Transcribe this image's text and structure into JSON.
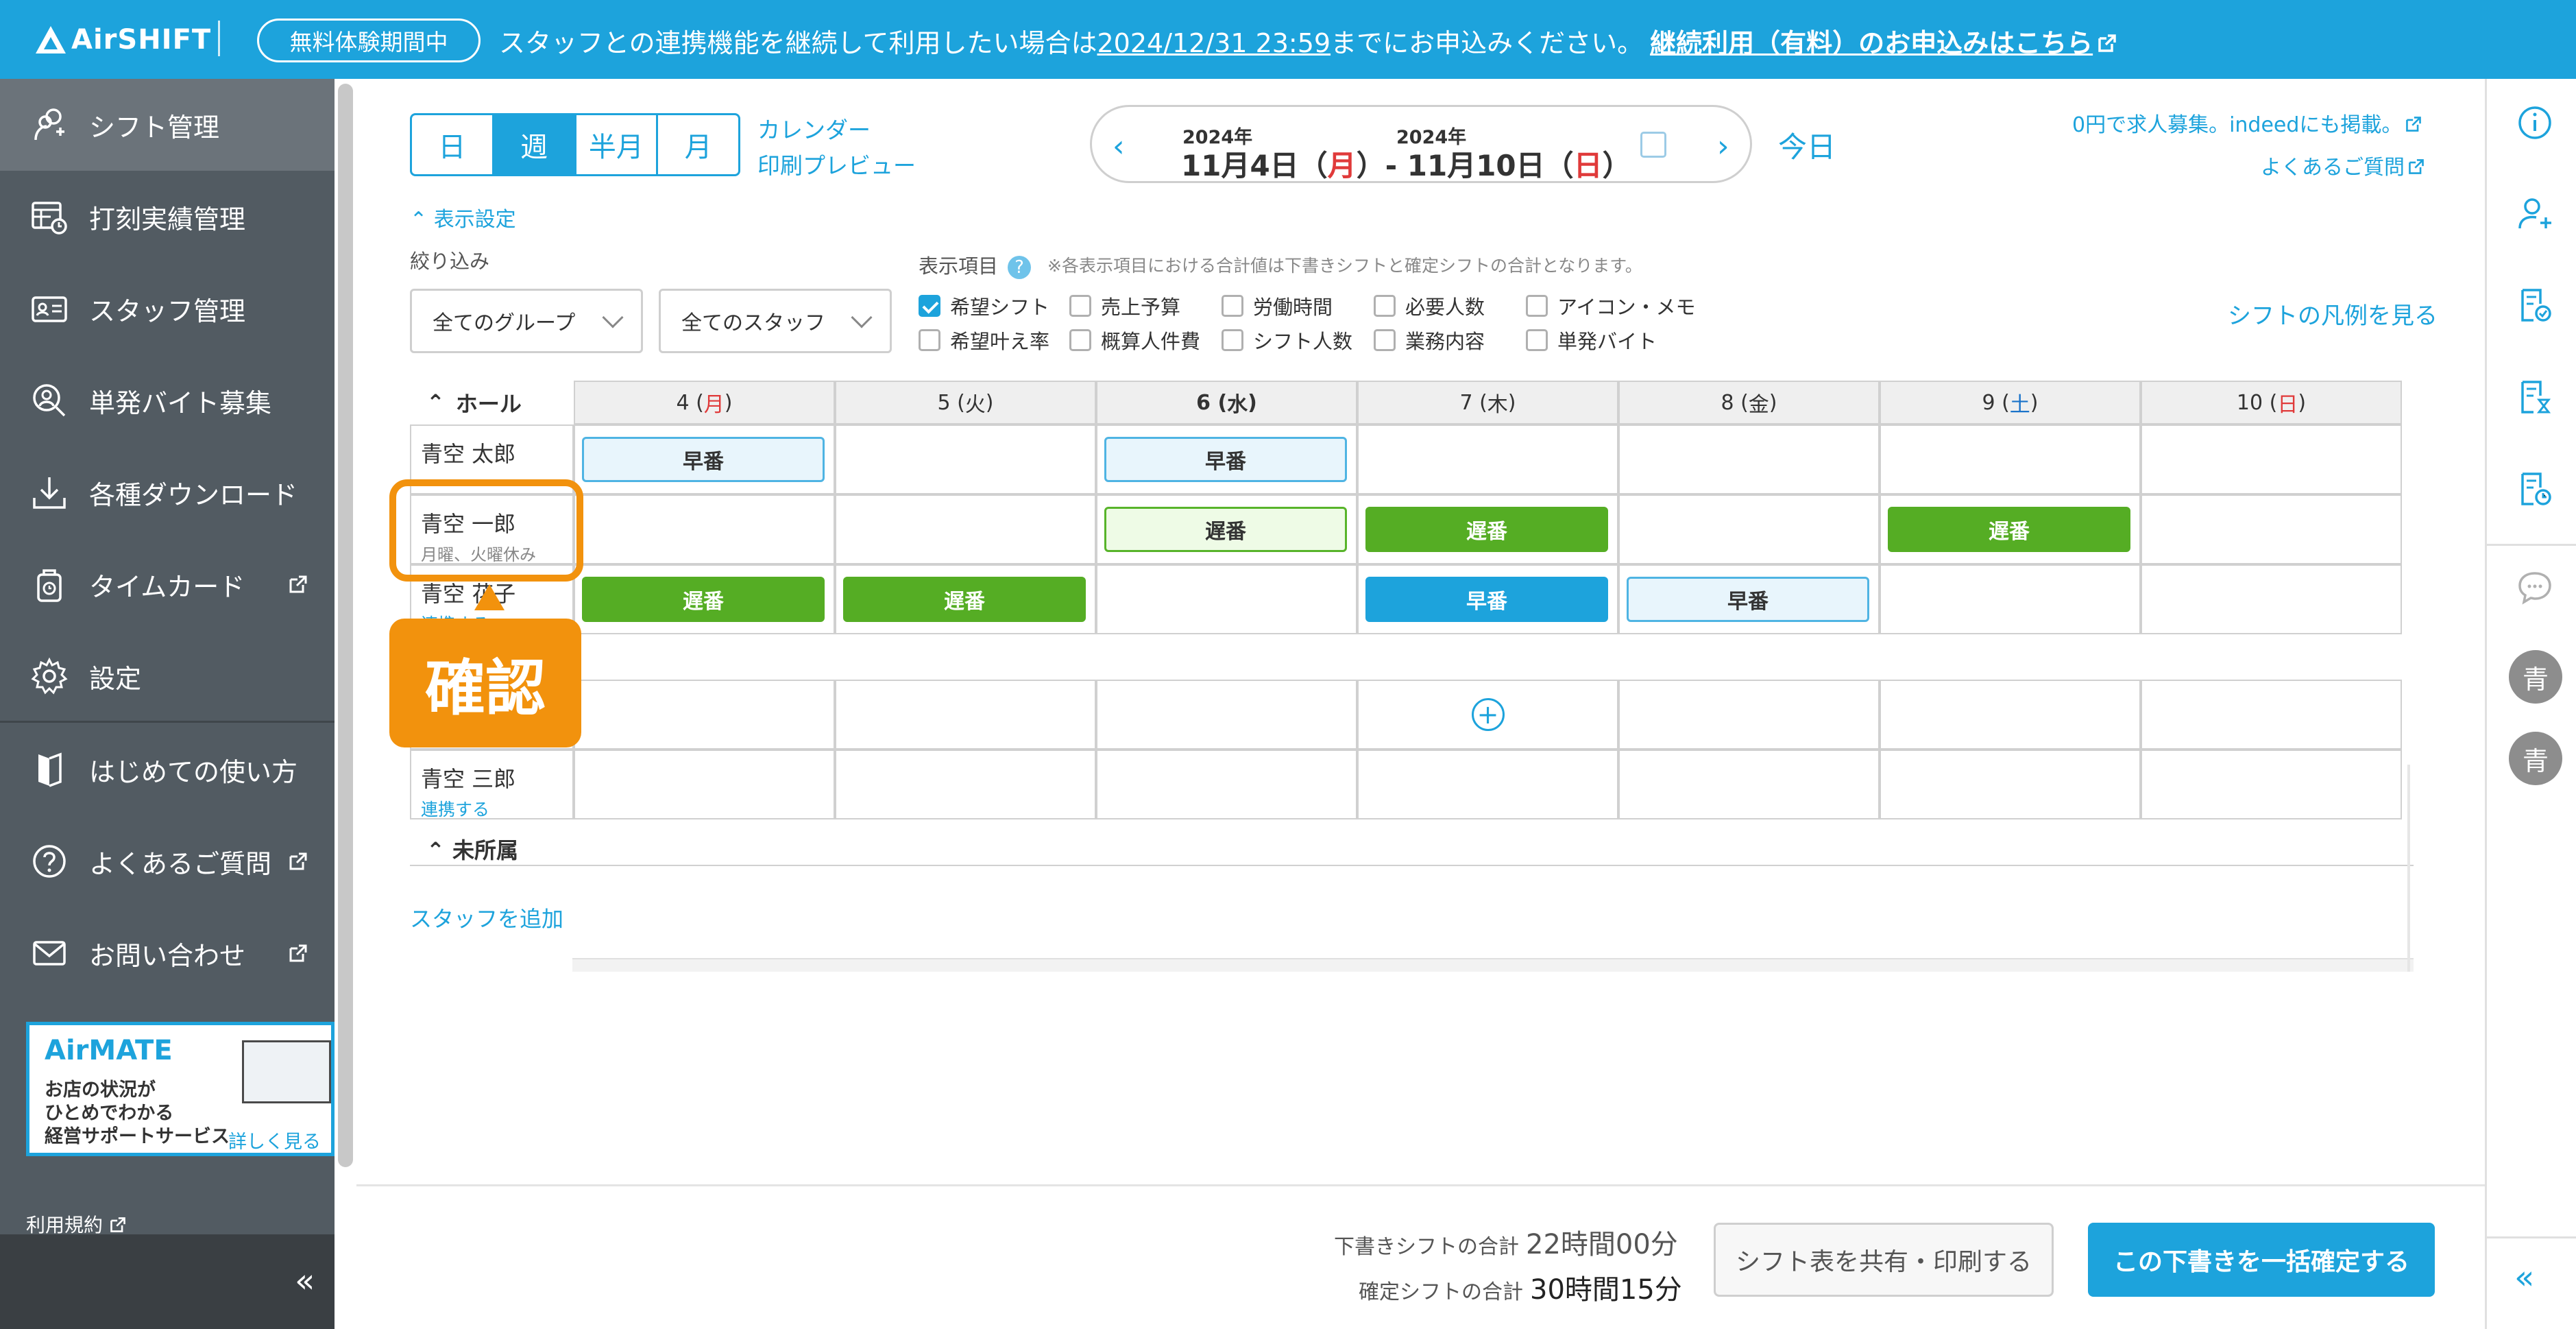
{
  "banner": {
    "brand": "AirSHIFT",
    "trial_badge": "無料体験期間中",
    "message_prefix": "スタッフとの連携機能を継続して利用したい場合は",
    "deadline": "2024/12/31 23:59",
    "message_suffix": "までにお申込みください。",
    "cta": "継続利用（有料）のお申込みはこちら",
    "bg_color": "#1da3dc"
  },
  "sidebar": {
    "items": [
      {
        "label": "シフト管理",
        "icon": "calendar-person-icon",
        "active": true
      },
      {
        "label": "打刻実績管理",
        "icon": "table-clock-icon"
      },
      {
        "label": "スタッフ管理",
        "icon": "id-card-icon"
      },
      {
        "label": "単発バイト募集",
        "icon": "person-search-icon"
      },
      {
        "label": "各種ダウンロード",
        "icon": "download-icon"
      },
      {
        "label": "タイムカード",
        "icon": "timecard-icon",
        "external": true
      },
      {
        "label": "設定",
        "icon": "gear-icon"
      },
      {
        "label": "はじめての使い方",
        "icon": "bookmark-icon"
      },
      {
        "label": "よくあるご質問",
        "icon": "question-icon",
        "external": true
      },
      {
        "label": "お問い合わせ",
        "icon": "mail-icon",
        "external": true
      }
    ],
    "ad": {
      "brand": "AirMATE",
      "desc_lines": [
        "お店の状況が",
        "ひとめでわかる",
        "経営サポートサービス"
      ],
      "more": "詳しく見る"
    },
    "terms": "利用規約",
    "collapse": "«"
  },
  "toolbar": {
    "views": [
      "日",
      "週",
      "半月",
      "月"
    ],
    "active_view": "週",
    "calendar_link": "カレンダー",
    "print_link": "印刷プレビュー",
    "year_start": "2024年",
    "year_end": "2024年",
    "range_start_md": "11月4日（",
    "range_start_dow": "月",
    "range_sep": "）- 11月10日（",
    "range_end_dow": "日",
    "range_close": "）",
    "today": "今日",
    "indeed_link": "0円で求人募集。indeedにも掲載。",
    "faq_link": "よくあるご質問"
  },
  "settings": {
    "toggle": "表示設定",
    "filter_label": "絞り込み",
    "group_select": "全てのグループ",
    "staff_select": "全てのスタッフ",
    "items_label": "表示項目",
    "note": "※各表示項目における合計値は下書きシフトと確定シフトの合計となります。",
    "checkboxes": [
      {
        "label": "希望シフト",
        "checked": true
      },
      {
        "label": "売上予算",
        "checked": false
      },
      {
        "label": "労働時間",
        "checked": false
      },
      {
        "label": "必要人数",
        "checked": false
      },
      {
        "label": "アイコン・メモ",
        "checked": false
      },
      {
        "label": "希望叶え率",
        "checked": false
      },
      {
        "label": "概算人件費",
        "checked": false
      },
      {
        "label": "シフト人数",
        "checked": false
      },
      {
        "label": "業務内容",
        "checked": false
      },
      {
        "label": "単発バイト",
        "checked": false
      }
    ],
    "legend_link": "シフトの凡例を見る"
  },
  "table": {
    "group": "ホール",
    "days": [
      {
        "num": "4",
        "dow": "月",
        "tone": "red"
      },
      {
        "num": "5",
        "dow": "火",
        "tone": ""
      },
      {
        "num": "6",
        "dow": "水",
        "tone": "",
        "bold": true
      },
      {
        "num": "7",
        "dow": "木",
        "tone": ""
      },
      {
        "num": "8",
        "dow": "金",
        "tone": ""
      },
      {
        "num": "9",
        "dow": "土",
        "tone": "blue"
      },
      {
        "num": "10",
        "dow": "日",
        "tone": "red"
      }
    ],
    "staff": [
      {
        "name": "青空 太郎",
        "sub": "",
        "link": "",
        "shifts": [
          {
            "day": 0,
            "label": "早番",
            "kind": "e-draft"
          },
          {
            "day": 2,
            "label": "早番",
            "kind": "e-draft"
          }
        ]
      },
      {
        "name": "青空 一郎",
        "sub": "月曜、火曜休み",
        "link": "",
        "shifts": [
          {
            "day": 2,
            "label": "遅番",
            "kind": "l-draft"
          },
          {
            "day": 3,
            "label": "遅番",
            "kind": "l-fix"
          },
          {
            "day": 5,
            "label": "遅番",
            "kind": "l-fix"
          }
        ]
      },
      {
        "name": "青空 花子",
        "sub": "",
        "link": "連携する",
        "shifts": [
          {
            "day": 0,
            "label": "遅番",
            "kind": "l-fix"
          },
          {
            "day": 1,
            "label": "遅番",
            "kind": "l-fix"
          },
          {
            "day": 3,
            "label": "早番",
            "kind": "e-fix"
          },
          {
            "day": 4,
            "label": "早番",
            "kind": "e-draft"
          }
        ]
      }
    ],
    "staff_b": [
      {
        "name": "",
        "sub": "",
        "link": ""
      },
      {
        "name": "青空 三郎",
        "sub": "",
        "link": "連携する"
      }
    ],
    "unassigned": "未所属",
    "add_staff": "スタッフを追加",
    "add_symbol": "+"
  },
  "callout": {
    "label": "確認",
    "color": "#f2920d"
  },
  "footer": {
    "draft_label": "下書きシフトの合計",
    "draft_value": "22時間00分",
    "fixed_label": "確定シフトの合計",
    "fixed_value": "30時間15分",
    "share_button": "シフト表を共有・印刷する",
    "confirm_button": "この下書きを一括確定する"
  },
  "rail": {
    "icons": [
      "info-icon",
      "add-person-icon",
      "doc-check-icon",
      "doc-hourglass-icon",
      "doc-clock-icon",
      "chat-icon"
    ],
    "avatars": [
      "青",
      "青"
    ],
    "collapse": "«"
  }
}
